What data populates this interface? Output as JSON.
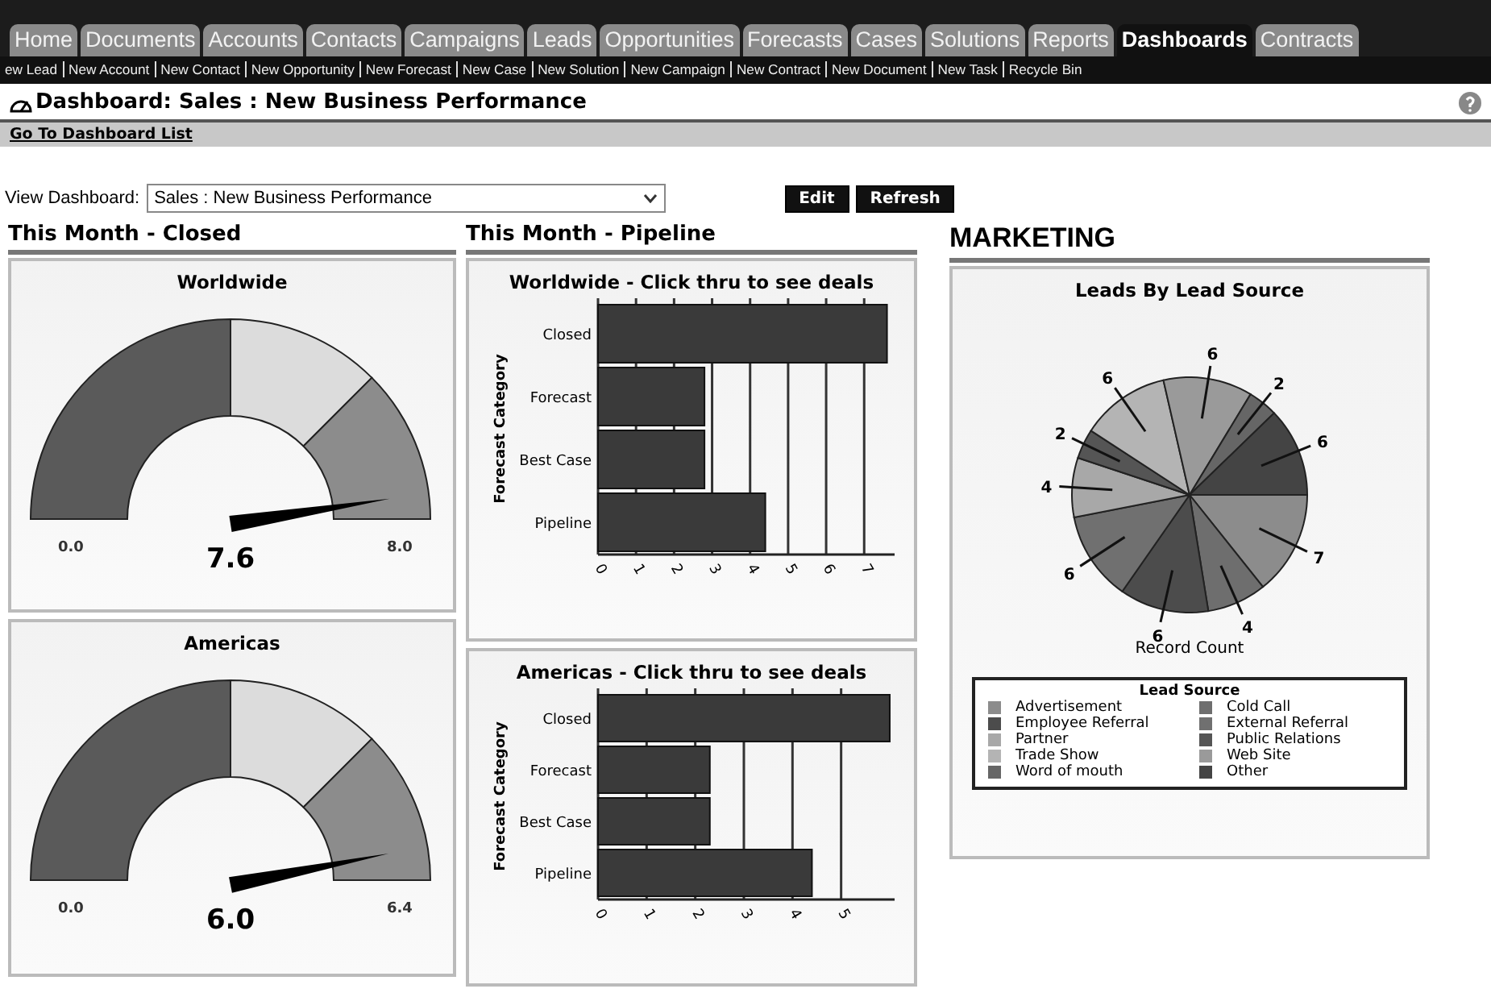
{
  "tabs": [
    {
      "label": "Home",
      "selected": false
    },
    {
      "label": "Documents",
      "selected": false
    },
    {
      "label": "Accounts",
      "selected": false
    },
    {
      "label": "Contacts",
      "selected": false
    },
    {
      "label": "Campaigns",
      "selected": false
    },
    {
      "label": "Leads",
      "selected": false
    },
    {
      "label": "Opportunities",
      "selected": false
    },
    {
      "label": "Forecasts",
      "selected": false
    },
    {
      "label": "Cases",
      "selected": false
    },
    {
      "label": "Solutions",
      "selected": false
    },
    {
      "label": "Reports",
      "selected": false
    },
    {
      "label": "Dashboards",
      "selected": true
    },
    {
      "label": "Contracts",
      "selected": false
    }
  ],
  "quick_links": [
    "ew Lead",
    "New Account",
    "New Contact",
    "New Opportunity",
    "New Forecast",
    "New Case",
    "New Solution",
    "New Campaign",
    "New Contract",
    "New Document",
    "New Task",
    "Recycle Bin"
  ],
  "page_title": "Dashboard: Sales : New Business Performance",
  "back_link": "Go To Dashboard List",
  "view_dashboard": {
    "label": "View Dashboard:",
    "value": "Sales : New Business Performance",
    "buttons": [
      "Edit",
      "Refresh"
    ]
  },
  "closed_column": {
    "heading": "This Month - Closed",
    "gauges": [
      {
        "title": "Worldwide",
        "min": "0.0",
        "max": "8.0",
        "value": "7.6"
      },
      {
        "title": "Americas",
        "min": "0.0",
        "max": "6.4",
        "value": "6.0"
      }
    ]
  },
  "pipeline_column": {
    "heading": "This Month - Pipeline",
    "charts": [
      {
        "chart_data": {
          "type": "bar",
          "orientation": "horizontal",
          "title": "Worldwide - Click thru to see deals",
          "ylabel": "Forecast Category",
          "categories": [
            "Closed",
            "Forecast",
            "Best Case",
            "Pipeline"
          ],
          "values": [
            7.6,
            2.8,
            2.8,
            4.4
          ],
          "xlim": [
            0,
            7.8
          ],
          "xticks": [
            0,
            1,
            2,
            3,
            4,
            5,
            6,
            7
          ],
          "grid": true
        }
      },
      {
        "chart_data": {
          "type": "bar",
          "orientation": "horizontal",
          "title": "Americas - Click thru to see deals",
          "ylabel": "Forecast Category",
          "categories": [
            "Closed",
            "Forecast",
            "Best Case",
            "Pipeline"
          ],
          "values": [
            6.0,
            2.3,
            2.3,
            4.4
          ],
          "xlim": [
            0,
            6.1
          ],
          "xticks": [
            0,
            1,
            2,
            3,
            4,
            5
          ],
          "grid": true
        }
      }
    ]
  },
  "marketing": {
    "heading": "MARKETING",
    "chart_data": {
      "type": "pie",
      "title": "Leads By Lead Source",
      "data_labels": true,
      "series": [
        {
          "name": "Record Count",
          "values": [
            7,
            4,
            6,
            6,
            4,
            2,
            6,
            6,
            2,
            6
          ]
        }
      ]
    },
    "legend": {
      "title": "Lead Source",
      "items": [
        {
          "label": "Advertisement",
          "color": "#8c8c8c"
        },
        {
          "label": "Cold Call",
          "color": "#6e6e6e"
        },
        {
          "label": "Employee Referral",
          "color": "#4c4c4c"
        },
        {
          "label": "External Referral",
          "color": "#707070"
        },
        {
          "label": "Partner",
          "color": "#a8a8a8"
        },
        {
          "label": "Public Relations",
          "color": "#555555"
        },
        {
          "label": "Trade Show",
          "color": "#b4b4b4"
        },
        {
          "label": "Web Site",
          "color": "#9a9a9a"
        },
        {
          "label": "Word of mouth",
          "color": "#666666"
        },
        {
          "label": "Other",
          "color": "#444444"
        }
      ]
    }
  }
}
